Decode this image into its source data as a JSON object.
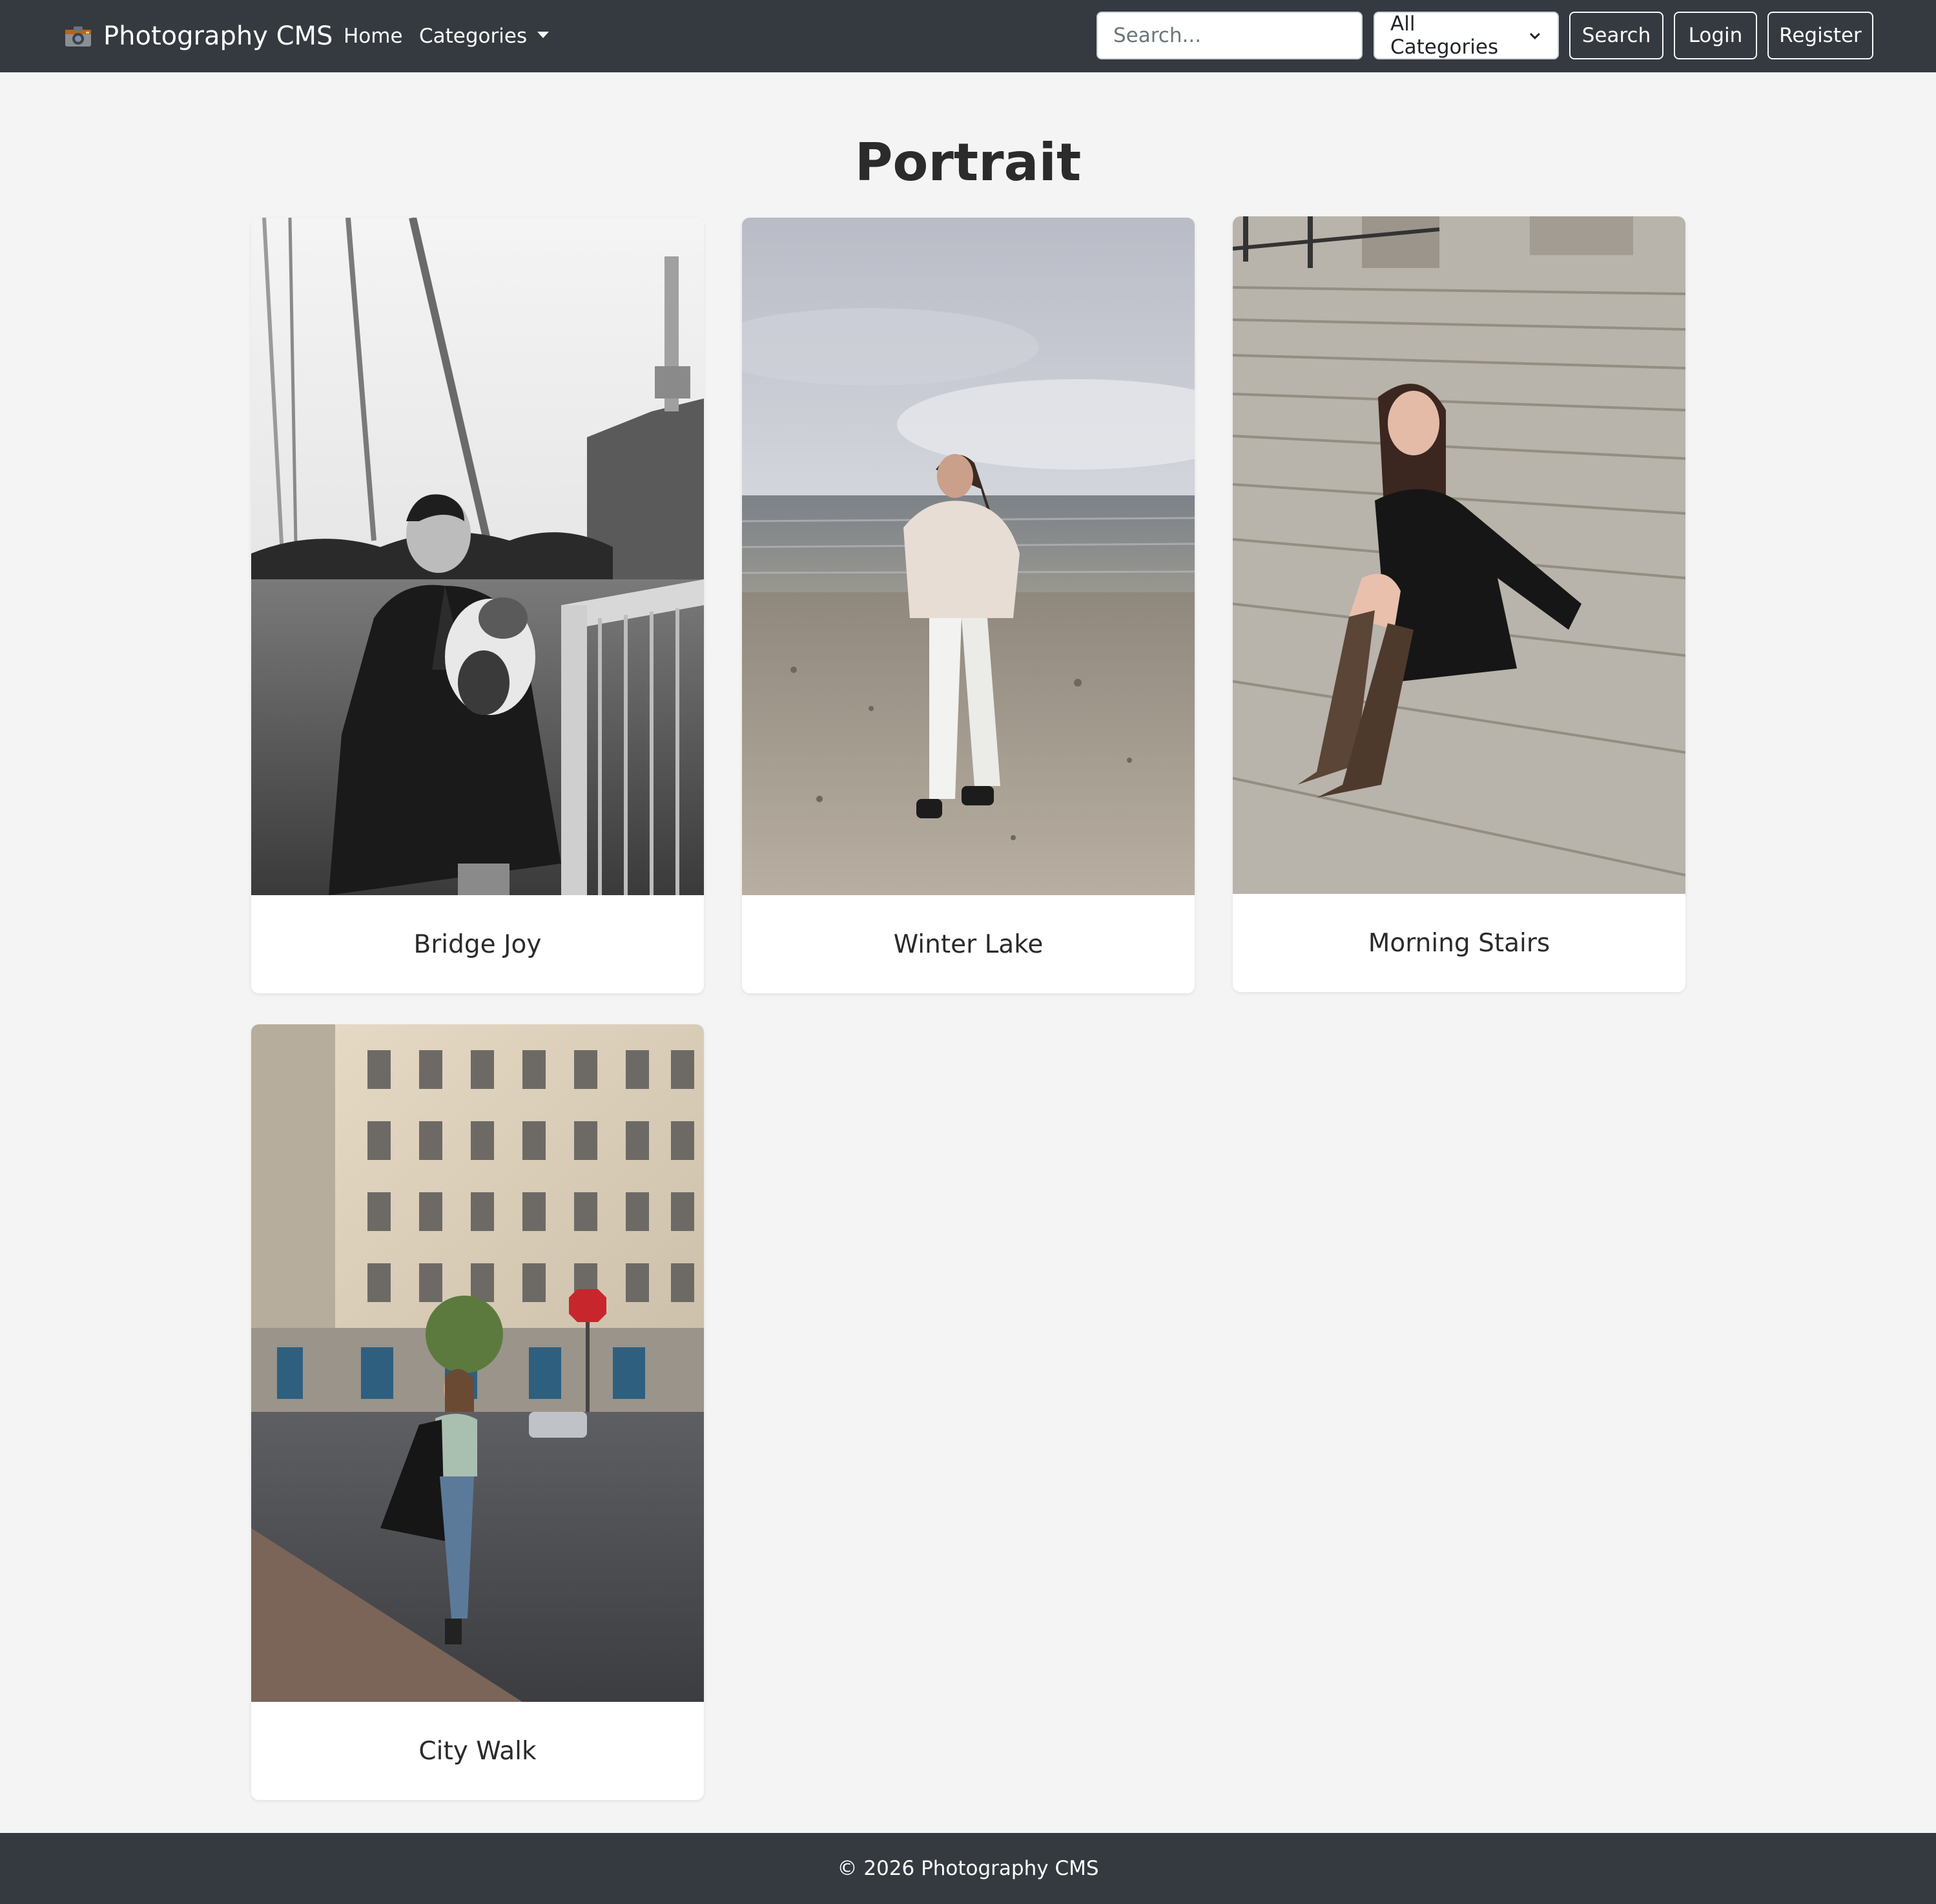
{
  "navbar": {
    "brand_icon": "camera-icon",
    "brand": "Photography CMS",
    "home": "Home",
    "categories": "Categories",
    "search_placeholder": "Search...",
    "category_select": "All Categories",
    "search_button": "Search",
    "login_button": "Login",
    "register_button": "Register"
  },
  "page": {
    "title": "Portrait"
  },
  "gallery": {
    "items": [
      {
        "title": "Bridge Joy"
      },
      {
        "title": "Winter Lake"
      },
      {
        "title": "Morning Stairs"
      },
      {
        "title": "City Walk"
      }
    ]
  },
  "footer": {
    "text": "© 2026 Photography CMS"
  },
  "colors": {
    "navbar": "#343a40",
    "background": "#f4f4f4",
    "card": "#ffffff"
  }
}
